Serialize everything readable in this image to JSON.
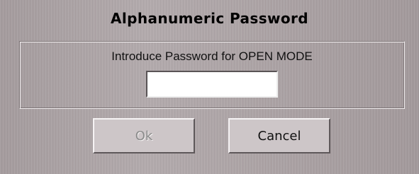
{
  "dialog": {
    "title": "Alphanumeric Password",
    "prompt": "Introduce Password for OPEN MODE",
    "password_value": "",
    "ok_label": "Ok",
    "ok_enabled": false,
    "cancel_label": "Cancel"
  },
  "colors": {
    "background": "#aca3a5",
    "button_face": "#cdc6c8",
    "disabled_text": "#8b8b8b"
  }
}
